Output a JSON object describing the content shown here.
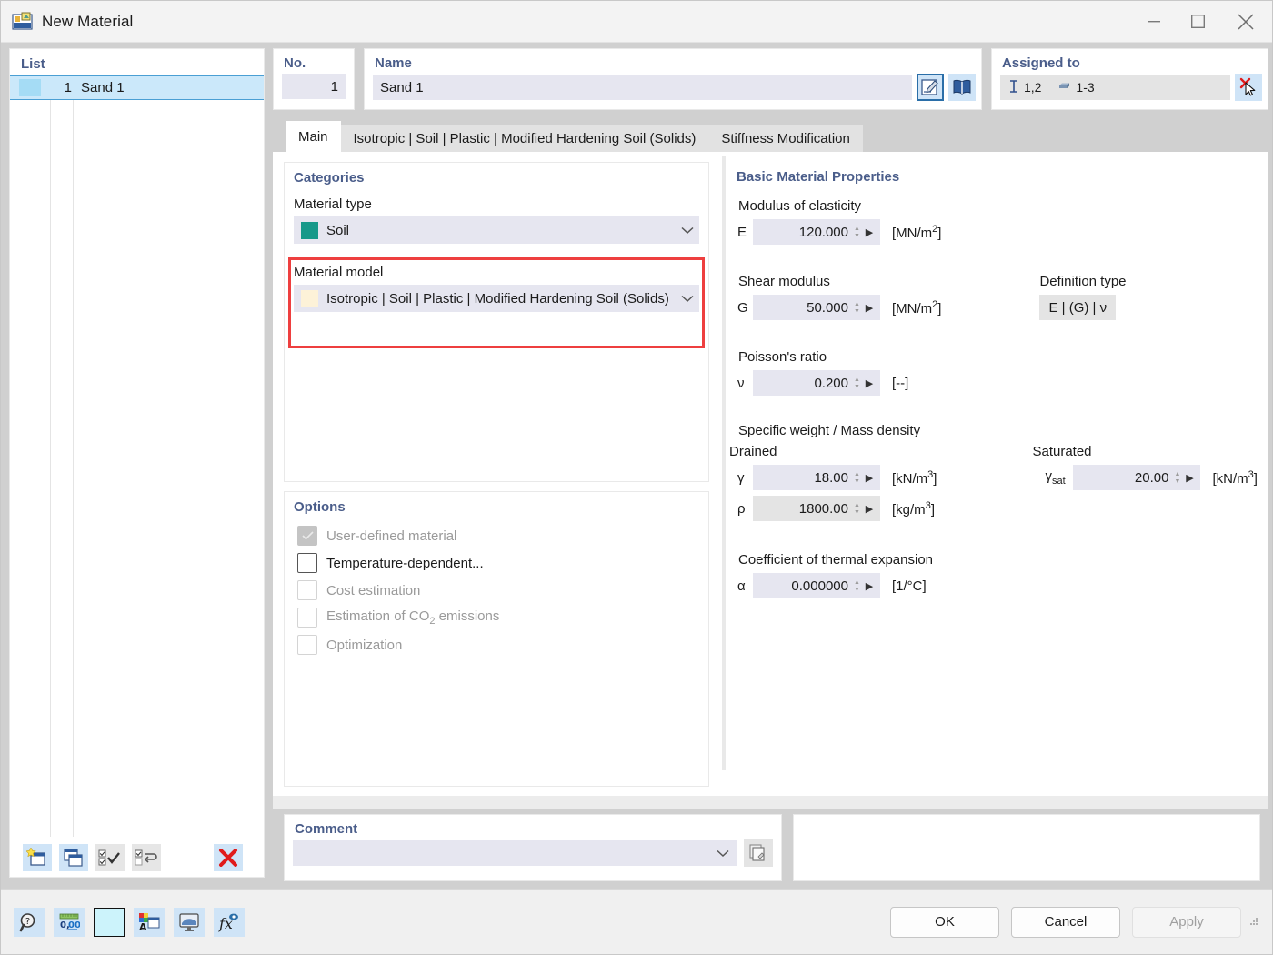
{
  "window": {
    "title": "New Material",
    "title_icon": "material-window-icon",
    "controls": {
      "minimize": "minimize-icon",
      "maximize": "maximize-icon",
      "close": "close-icon"
    }
  },
  "list_panel": {
    "title": "List",
    "rows": [
      {
        "no": "1",
        "name": "Sand 1",
        "swatch": "#a5dcf5"
      }
    ],
    "toolbar": [
      {
        "name": "new-material-button",
        "icon": "new-window-star-icon"
      },
      {
        "name": "copy-material-button",
        "icon": "copy-window-icon"
      },
      {
        "name": "select-all-button",
        "icon": "checkmarks-icon"
      },
      {
        "name": "invert-selection-button",
        "icon": "checkbox-swap-icon"
      },
      {
        "name": "delete-material-button",
        "icon": "red-x-icon"
      }
    ]
  },
  "header": {
    "no_label": "No.",
    "no_value": "1",
    "name_label": "Name",
    "name_value": "Sand 1",
    "name_buttons": [
      {
        "name": "edit-name-button",
        "icon": "pencil-edit-icon",
        "selected": true
      },
      {
        "name": "material-library-button",
        "icon": "book-icon",
        "selected": false
      }
    ],
    "assigned_label": "Assigned to",
    "assigned_items": [
      {
        "icon": "member-icon",
        "value": "1,2"
      },
      {
        "icon": "solid-icon",
        "value": "1-3"
      }
    ],
    "assigned_clear_button": "clear-assignment-button"
  },
  "tabs": [
    {
      "label": "Main",
      "active": true
    },
    {
      "label": "Isotropic | Soil | Plastic | Modified Hardening Soil (Solids)",
      "active": false
    },
    {
      "label": "Stiffness Modification",
      "active": false
    }
  ],
  "categories": {
    "title": "Categories",
    "material_type_label": "Material type",
    "material_type_value": "Soil",
    "material_type_swatch": "#17998a",
    "material_model_label": "Material model",
    "material_model_value": "Isotropic | Soil | Plastic | Modified Hardening Soil (Solids)",
    "material_model_swatch": "#fdf2d8",
    "highlight_color": "#ee3f3f"
  },
  "options": {
    "title": "Options",
    "items": [
      {
        "label": "User-defined material",
        "checked": true,
        "disabled": true
      },
      {
        "label": "Temperature-dependent...",
        "checked": false,
        "disabled": false
      },
      {
        "label": "Cost estimation",
        "checked": false,
        "disabled": true
      },
      {
        "label": "Estimation of CO2 emissions",
        "checked": false,
        "disabled": true
      },
      {
        "label": "Optimization",
        "checked": false,
        "disabled": true
      }
    ]
  },
  "properties": {
    "title": "Basic Material Properties",
    "modulus_group": "Modulus of elasticity",
    "modulus": {
      "symbol": "E",
      "value": "120.000",
      "unit": "[MN/m2]"
    },
    "shear_group": "Shear modulus",
    "shear": {
      "symbol": "G",
      "value": "50.000",
      "unit": "[MN/m2]"
    },
    "definition_type_label": "Definition type",
    "definition_type_value": "E | (G) | ν",
    "poisson_group": "Poisson's ratio",
    "poisson": {
      "symbol": "ν",
      "value": "0.200",
      "unit": "[--]"
    },
    "weight_group": "Specific weight / Mass density",
    "drained_label": "Drained",
    "saturated_label": "Saturated",
    "gamma": {
      "symbol": "γ",
      "value": "18.00",
      "unit": "[kN/m3]"
    },
    "rho": {
      "symbol": "ρ",
      "value": "1800.00",
      "unit": "[kg/m3]"
    },
    "gamma_sat": {
      "symbol": "γsat",
      "value": "20.00",
      "unit": "[kN/m3]"
    },
    "thermal_group": "Coefficient of thermal expansion",
    "alpha": {
      "symbol": "α",
      "value": "0.000000",
      "unit": "[1/°C]"
    }
  },
  "comment": {
    "title": "Comment",
    "value": "",
    "button": "comment-templates-button"
  },
  "footer": {
    "tools": [
      {
        "name": "help-button",
        "icon": "help-magnifier-icon"
      },
      {
        "name": "units-button",
        "icon": "number-format-icon"
      },
      {
        "name": "color-button",
        "icon": "color-swatch-icon"
      },
      {
        "name": "display-properties-button",
        "icon": "color-palette-window-icon"
      },
      {
        "name": "visual-settings-button",
        "icon": "monitor-icon"
      },
      {
        "name": "formula-button",
        "icon": "fx-icon"
      }
    ],
    "buttons": [
      {
        "label": "OK",
        "name": "ok-button",
        "disabled": false
      },
      {
        "label": "Cancel",
        "name": "cancel-button",
        "disabled": false
      },
      {
        "label": "Apply",
        "name": "apply-button",
        "disabled": true
      }
    ]
  }
}
